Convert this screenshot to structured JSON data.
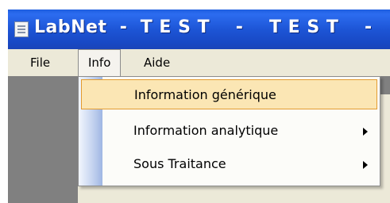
{
  "window": {
    "title": "LabNet  -  T E S T    -    T E S T    -"
  },
  "menubar": {
    "items": [
      {
        "label": "File"
      },
      {
        "label": "Info"
      },
      {
        "label": "Aide"
      }
    ]
  },
  "dropdown": {
    "items": [
      {
        "label": "Information générique",
        "has_submenu": false,
        "highlighted": true
      },
      {
        "label": "Information analytique",
        "has_submenu": true
      },
      {
        "label": "Sous Traitance",
        "has_submenu": true
      }
    ]
  },
  "colors": {
    "titlebar": "#1d55d6",
    "menubar_bg": "#ece9d8",
    "highlight_bg": "#fbe6b4",
    "highlight_border": "#e39b2f",
    "client_gray": "#808080"
  }
}
